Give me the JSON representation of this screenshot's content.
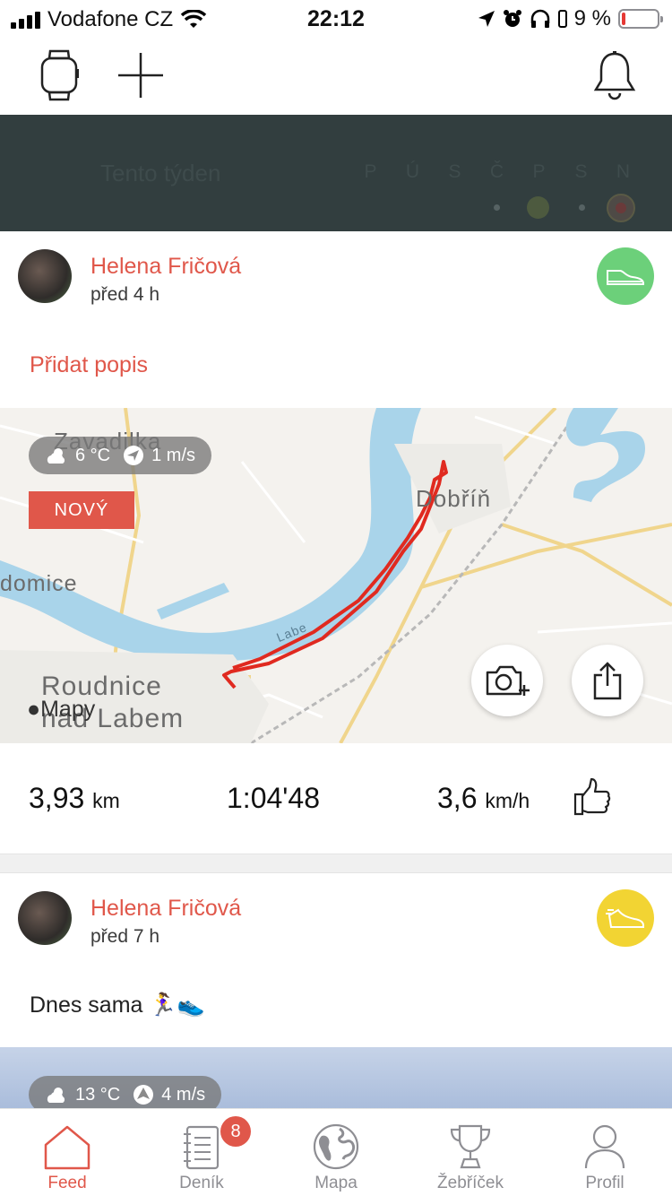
{
  "status_bar": {
    "carrier": "Vodafone CZ",
    "time": "22:12",
    "battery_percent": "9 %",
    "battery_level": 0.09
  },
  "top_nav": {
    "icons": [
      "watch-icon",
      "plus-icon",
      "bell-icon"
    ]
  },
  "banner": {
    "title": "Tento týden",
    "days": [
      "P",
      "Ú",
      "S",
      "Č",
      "P",
      "S",
      "N"
    ]
  },
  "feed": [
    {
      "user": "Helena Fričová",
      "time": "před 4 h",
      "sport_icon": "shoe-icon",
      "sport_color": "#6cd07a",
      "add_description": "Přidat popis",
      "weather": {
        "temp": "6 °C",
        "wind": "1 m/s"
      },
      "badge": "NOVÝ",
      "map_labels": [
        "Zavadilka",
        "Dobříň",
        "domice",
        "Roudnice",
        "nad Labem",
        "Labe"
      ],
      "map_attribution": "Mapy",
      "stats": {
        "distance": "3,93",
        "distance_unit": "km",
        "duration": "1:04'48",
        "speed": "3,6",
        "speed_unit": "km/h"
      }
    },
    {
      "user": "Helena Fričová",
      "time": "před 7 h",
      "sport_icon": "running-shoe-icon",
      "sport_color": "#f2d433",
      "text": "Dnes sama 🏃‍♀️👟",
      "weather": {
        "temp": "13 °C",
        "wind": "4 m/s"
      }
    }
  ],
  "tab_bar": {
    "tabs": [
      {
        "label": "Feed",
        "icon": "home-icon",
        "active": true
      },
      {
        "label": "Deník",
        "icon": "notebook-icon",
        "badge": "8"
      },
      {
        "label": "Mapa",
        "icon": "globe-icon"
      },
      {
        "label": "Žebříček",
        "icon": "trophy-icon"
      },
      {
        "label": "Profil",
        "icon": "person-icon"
      }
    ]
  },
  "colors": {
    "accent": "#e0574a",
    "banner_bg": "#323e3f",
    "route": "#e02a20",
    "river": "#a9d4ea"
  }
}
